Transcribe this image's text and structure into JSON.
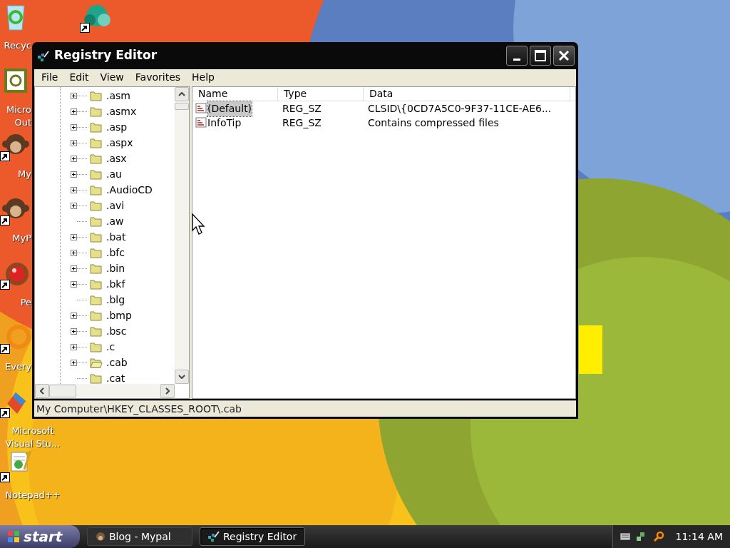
{
  "desktop_icons": [
    {
      "kind": "bin",
      "shortcut": false,
      "lines": [
        "Recyc"
      ]
    },
    {
      "kind": "mail",
      "shortcut": false,
      "lines": [
        "Micro",
        "Out"
      ]
    },
    {
      "kind": "monkey",
      "shortcut": true,
      "lines": [
        "My"
      ]
    },
    {
      "kind": "monkey",
      "shortcut": true,
      "lines": [
        "MyP"
      ]
    },
    {
      "kind": "ball",
      "shortcut": true,
      "lines": [
        "Pe"
      ]
    },
    {
      "kind": "ring",
      "shortcut": true,
      "lines": [
        "Every"
      ]
    },
    {
      "kind": "studio",
      "shortcut": true,
      "lines": [
        "Microsoft",
        "Visual Stu..."
      ]
    },
    {
      "kind": "notepad",
      "shortcut": true,
      "lines": [
        "Notepad++"
      ]
    }
  ],
  "desktop_shortcut": {
    "kind": "cloud",
    "shortcut": true
  },
  "window": {
    "title": "Registry Editor",
    "menu": [
      "File",
      "Edit",
      "View",
      "Favorites",
      "Help"
    ],
    "tree": [
      {
        "label": ".asm",
        "has_children": true,
        "selected": false
      },
      {
        "label": ".asmx",
        "has_children": true,
        "selected": false
      },
      {
        "label": ".asp",
        "has_children": true,
        "selected": false
      },
      {
        "label": ".aspx",
        "has_children": true,
        "selected": false
      },
      {
        "label": ".asx",
        "has_children": true,
        "selected": false
      },
      {
        "label": ".au",
        "has_children": true,
        "selected": false
      },
      {
        "label": ".AudioCD",
        "has_children": true,
        "selected": false
      },
      {
        "label": ".avi",
        "has_children": true,
        "selected": false
      },
      {
        "label": ".aw",
        "has_children": false,
        "selected": false
      },
      {
        "label": ".bat",
        "has_children": true,
        "selected": false
      },
      {
        "label": ".bfc",
        "has_children": true,
        "selected": false
      },
      {
        "label": ".bin",
        "has_children": true,
        "selected": false
      },
      {
        "label": ".bkf",
        "has_children": true,
        "selected": false
      },
      {
        "label": ".blg",
        "has_children": false,
        "selected": false
      },
      {
        "label": ".bmp",
        "has_children": true,
        "selected": false
      },
      {
        "label": ".bsc",
        "has_children": true,
        "selected": false
      },
      {
        "label": ".c",
        "has_children": true,
        "selected": false
      },
      {
        "label": ".cab",
        "has_children": true,
        "selected": true
      },
      {
        "label": ".cat",
        "has_children": false,
        "selected": false
      }
    ],
    "columns": [
      "Name",
      "Type",
      "Data"
    ],
    "rows": [
      {
        "name": "(Default)",
        "type": "REG_SZ",
        "data": "CLSID\\{0CD7A5C0-9F37-11CE-AE6...",
        "selected": true
      },
      {
        "name": "InfoTip",
        "type": "REG_SZ",
        "data": "Contains compressed files",
        "selected": false
      }
    ],
    "status_bar": "My Computer\\HKEY_CLASSES_ROOT\\.cab"
  },
  "taskbar": {
    "start": "start",
    "tasks": [
      {
        "label": "Blog - Mypal",
        "kind": "browser",
        "selected": false
      },
      {
        "label": "Registry Editor",
        "kind": "regedit",
        "selected": true
      }
    ],
    "clock": "11:14 AM"
  }
}
